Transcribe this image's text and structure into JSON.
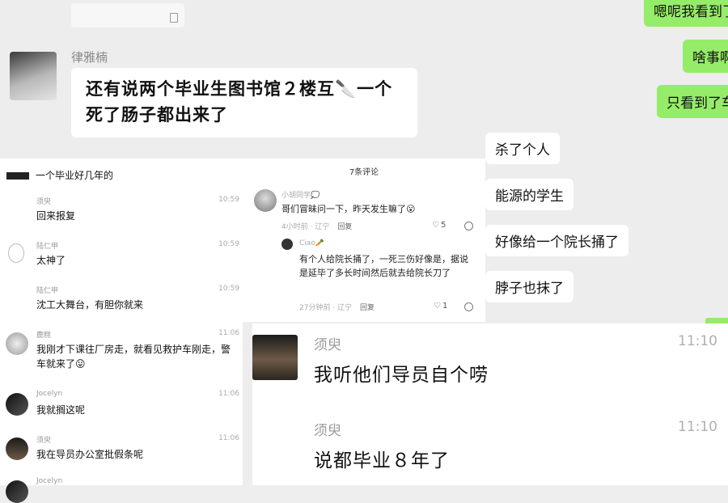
{
  "top_snippet": "",
  "main_chat": {
    "sender": "律雅楠",
    "message": "还有说两个毕业生图书馆２楼互🔪一个死了肠子都出来了",
    "right_green": [
      "嗯呢我看到了",
      "啥事啊",
      "只看到了车"
    ],
    "right_white": [
      "杀了个人",
      "能源的学生",
      "好像给一个院长捅了",
      "脖子也抹了"
    ]
  },
  "left_panel": {
    "header": "一个毕业好几年的",
    "comments": [
      {
        "name": "须臾",
        "time": "10:59",
        "text": "回来报复"
      },
      {
        "name": "陆仁甲",
        "time": "10:59",
        "text": "太神了"
      },
      {
        "name": "陆仁甲",
        "time": "10:59",
        "text": "沈工大舞台，有胆你就来"
      },
      {
        "name": "鹿糕",
        "time": "11:06",
        "text": "我刚才下课往厂房走，就看见救护车刚走，警车就来了😛"
      },
      {
        "name": "Jocelyn",
        "time": "11:06",
        "text": "我就搁这呢"
      },
      {
        "name": "须臾",
        "time": "11:06",
        "text": "我在导员办公室批假条呢"
      },
      {
        "name": "Jocelyn",
        "time": "",
        "text": ""
      }
    ]
  },
  "right_panel": {
    "title": "7条评论",
    "c1": {
      "name": "小胡同学💭",
      "text": "哥们冒昧问一下，昨天发生嘛了😮",
      "meta": "4小时前 · 辽宁",
      "reply": "回复",
      "likes": "5"
    },
    "c2": {
      "name": "Ciao🥕",
      "text": "有个人给院长捅了，一死三伤好像是，据说是延毕了多长时间然后就去给院长刀了",
      "meta": "27分钟前 · 辽宁",
      "reply": "回复",
      "likes": "1"
    }
  },
  "bottom_panel": {
    "messages": [
      {
        "name": "须臾",
        "time": "11:10",
        "text": "我听他们导员自个唠"
      },
      {
        "name": "须臾",
        "time": "11:10",
        "text": "说都毕业８年了"
      }
    ]
  }
}
